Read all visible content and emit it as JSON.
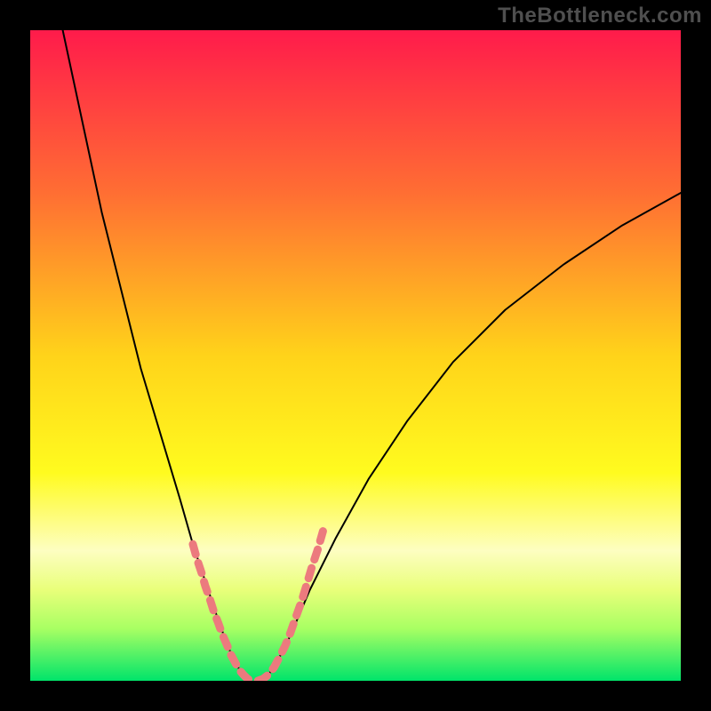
{
  "watermark": "TheBottleneck.com",
  "chart_data": {
    "type": "line",
    "title": "",
    "xlabel": "",
    "ylabel": "",
    "xlim": [
      0,
      100
    ],
    "ylim": [
      0,
      100
    ],
    "grid": false,
    "legend": false,
    "background_gradient": {
      "stops": [
        {
          "offset": 0.0,
          "color": "#ff1b4b"
        },
        {
          "offset": 0.25,
          "color": "#ff6e33"
        },
        {
          "offset": 0.5,
          "color": "#ffd31a"
        },
        {
          "offset": 0.68,
          "color": "#fffb1f"
        },
        {
          "offset": 0.8,
          "color": "#fdfec1"
        },
        {
          "offset": 0.86,
          "color": "#e9ff7a"
        },
        {
          "offset": 0.92,
          "color": "#a8ff63"
        },
        {
          "offset": 1.0,
          "color": "#00e46a"
        }
      ]
    },
    "series": [
      {
        "name": "left_curve",
        "color": "#000000",
        "width": 2,
        "x": [
          5,
          8,
          11,
          14,
          17,
          20,
          23,
          25,
          27,
          29,
          30.5,
          32,
          33
        ],
        "y": [
          100,
          86,
          72,
          60,
          48,
          38,
          28,
          21,
          15,
          9,
          5,
          2,
          0
        ]
      },
      {
        "name": "right_curve",
        "color": "#000000",
        "width": 2,
        "x": [
          36,
          38,
          40,
          43,
          47,
          52,
          58,
          65,
          73,
          82,
          91,
          100
        ],
        "y": [
          0,
          3,
          7,
          14,
          22,
          31,
          40,
          49,
          57,
          64,
          70,
          75
        ]
      },
      {
        "name": "left_dotted_overlay",
        "color": "#ec7a7e",
        "marker": "rounded-dash",
        "width": 9,
        "x": [
          25.0,
          25.6,
          26.3,
          26.9,
          27.6,
          28.2,
          28.9,
          29.5,
          30.2,
          30.8,
          31.5,
          32.1,
          32.8,
          33.4,
          34.1
        ],
        "y": [
          21.0,
          18.8,
          16.7,
          14.6,
          12.6,
          10.7,
          8.9,
          7.2,
          5.6,
          4.1,
          2.8,
          1.7,
          0.9,
          0.3,
          0.0
        ]
      },
      {
        "name": "right_dotted_overlay",
        "color": "#ec7a7e",
        "marker": "rounded-dash",
        "width": 9,
        "x": [
          35.0,
          35.8,
          36.7,
          37.5,
          38.3,
          39.2,
          40.0,
          40.8,
          41.7,
          42.5,
          43.3,
          44.2,
          45.0
        ],
        "y": [
          0.0,
          0.3,
          1.0,
          2.1,
          3.6,
          5.4,
          7.4,
          9.7,
          12.2,
          14.8,
          17.5,
          20.2,
          23.0
        ]
      }
    ]
  }
}
